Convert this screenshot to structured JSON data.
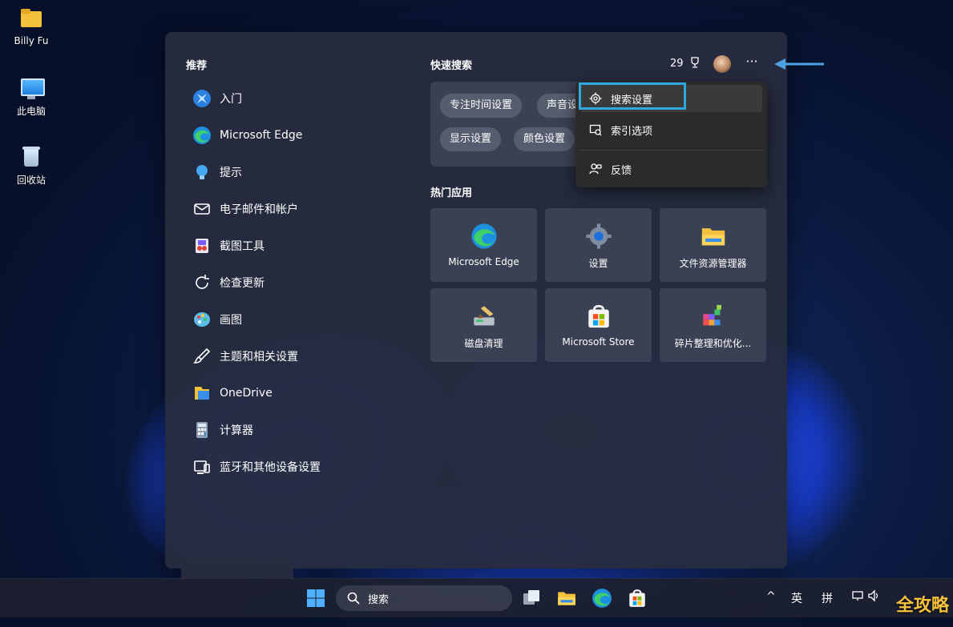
{
  "desktop": {
    "icons": [
      {
        "label": "Billy Fu"
      },
      {
        "label": "此电脑"
      },
      {
        "label": "回收站"
      }
    ]
  },
  "panel": {
    "recommended_title": "推荐",
    "recommended": [
      {
        "label": "入门",
        "icon": "getstarted-icon"
      },
      {
        "label": "Microsoft Edge",
        "icon": "edge-icon"
      },
      {
        "label": "提示",
        "icon": "tips-icon"
      },
      {
        "label": "电子邮件和帐户",
        "icon": "mail-icon"
      },
      {
        "label": "截图工具",
        "icon": "snipping-icon"
      },
      {
        "label": "检查更新",
        "icon": "update-icon"
      },
      {
        "label": "画图",
        "icon": "paint-icon"
      },
      {
        "label": "主题和相关设置",
        "icon": "brush-icon"
      },
      {
        "label": "OneDrive",
        "icon": "onedrive-icon"
      },
      {
        "label": "计算器",
        "icon": "calculator-icon"
      },
      {
        "label": "蓝牙和其他设备设置",
        "icon": "bluetooth-devices-icon"
      }
    ],
    "quick_search_title": "快速搜索",
    "quick_search_chips": [
      "专注时间设置",
      "声音设",
      "显示设置",
      "颜色设置"
    ],
    "top_apps_title": "热门应用",
    "top_apps": [
      {
        "label": "Microsoft Edge",
        "icon": "edge-icon"
      },
      {
        "label": "设置",
        "icon": "settings-gear-icon"
      },
      {
        "label": "文件资源管理器",
        "icon": "file-explorer-icon"
      },
      {
        "label": "磁盘清理",
        "icon": "disk-cleanup-icon"
      },
      {
        "label": "Microsoft Store",
        "icon": "store-icon"
      },
      {
        "label": "碎片整理和优化...",
        "icon": "defrag-icon"
      }
    ],
    "rewards_points": "29",
    "more_label": "···"
  },
  "context_menu": {
    "items": [
      {
        "label": "搜索设置",
        "icon": "gear-icon"
      },
      {
        "label": "索引选项",
        "icon": "index-icon"
      },
      {
        "label": "反馈",
        "icon": "feedback-icon"
      }
    ]
  },
  "taskbar": {
    "search_placeholder": "搜索",
    "tray": {
      "chevron": "^",
      "ime_lang": "英",
      "ime_mode": "拼"
    }
  },
  "watermark": "全攻略"
}
